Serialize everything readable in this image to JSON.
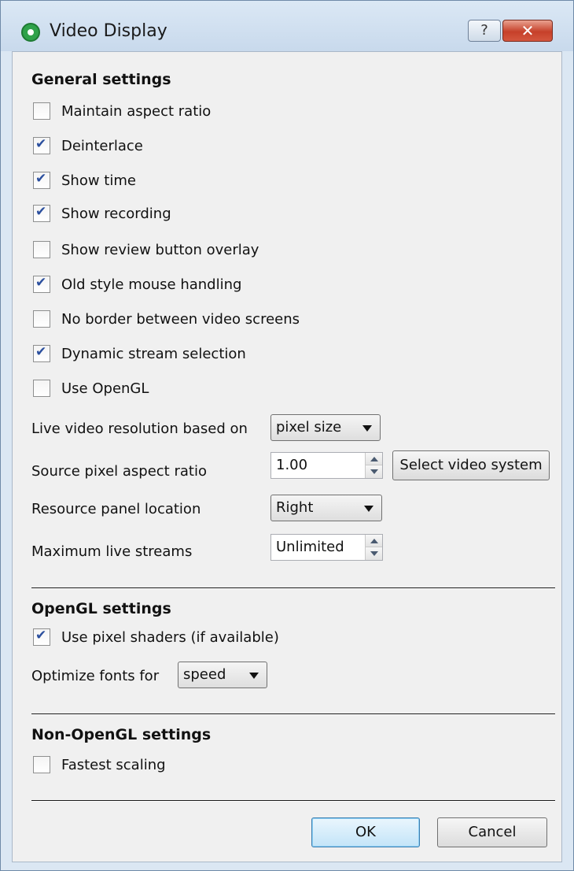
{
  "window": {
    "title": "Video Display",
    "help_label": "?",
    "close_label": "✕"
  },
  "general": {
    "title": "General settings",
    "options": [
      {
        "label": "Maintain aspect ratio",
        "checked": false
      },
      {
        "label": "Deinterlace",
        "checked": true
      },
      {
        "label": "Show time",
        "checked": true
      },
      {
        "label": "Show recording",
        "checked": true
      },
      {
        "label": "Show review button overlay",
        "checked": false
      },
      {
        "label": "Old style mouse handling",
        "checked": true
      },
      {
        "label": "No border between video screens",
        "checked": false
      },
      {
        "label": "Dynamic stream selection",
        "checked": true
      },
      {
        "label": "Use OpenGL",
        "checked": false
      }
    ],
    "live_resolution_label": "Live video resolution based on",
    "live_resolution_value": "pixel size",
    "source_aspect_label": "Source pixel aspect ratio",
    "source_aspect_value": "1.00",
    "select_video_system_label": "Select video system",
    "resource_panel_label": "Resource panel location",
    "resource_panel_value": "Right",
    "max_streams_label": "Maximum live streams",
    "max_streams_value": "Unlimited"
  },
  "opengl": {
    "title": "OpenGL settings",
    "pixel_shaders_label": "Use pixel shaders (if available)",
    "pixel_shaders_checked": true,
    "optimize_fonts_label": "Optimize fonts for",
    "optimize_fonts_value": "speed"
  },
  "non_opengl": {
    "title": "Non-OpenGL settings",
    "fastest_scaling_label": "Fastest scaling",
    "fastest_scaling_checked": false
  },
  "footer": {
    "ok_label": "OK",
    "cancel_label": "Cancel"
  }
}
